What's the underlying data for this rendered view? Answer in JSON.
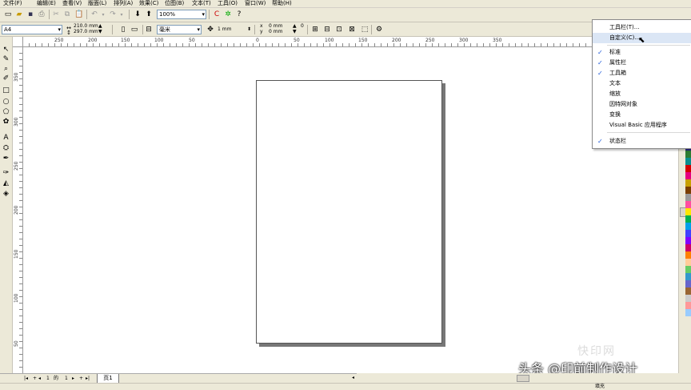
{
  "menu": [
    "文件(F)",
    "编辑(E)",
    "查看(V)",
    "版面(L)",
    "排列(A)",
    "效果(C)",
    "位图(B)",
    "文本(T)",
    "工具(O)",
    "窗口(W)",
    "帮助(H)"
  ],
  "toolbar": {
    "zoom": "100%"
  },
  "property_bar": {
    "paper_size": "A4",
    "width": "210.0 mm",
    "height": "297.0 mm",
    "units": "毫米",
    "nudge": "1 mm",
    "dup_x": "0 mm",
    "dup_y": "0 mm",
    "dup_x_label": "x",
    "dup_y_label": "y",
    "spin_val": "0"
  },
  "rulers": {
    "horizontal": [
      "250",
      "200",
      "150",
      "100",
      "50",
      "0",
      "50",
      "100",
      "150",
      "200",
      "250",
      "300",
      "350"
    ],
    "vertical": [
      "350",
      "300",
      "250",
      "200",
      "150",
      "100",
      "50"
    ]
  },
  "page_nav": {
    "current": "1",
    "of": "的",
    "total": "1",
    "tab": "页1"
  },
  "context_menu": {
    "items": [
      {
        "label": "工具栏(T)...",
        "checked": false
      },
      {
        "label": "自定义(C)...",
        "checked": false,
        "highlight": true
      },
      {
        "label": "标准",
        "checked": true
      },
      {
        "label": "属性栏",
        "checked": true
      },
      {
        "label": "工具箱",
        "checked": true
      },
      {
        "label": "文本",
        "checked": false
      },
      {
        "label": "缩放",
        "checked": false
      },
      {
        "label": "因特网对象",
        "checked": false
      },
      {
        "label": "变换",
        "checked": false
      },
      {
        "label": "Visual Basic 应用程序",
        "checked": false
      },
      {
        "label": "状态栏",
        "checked": true
      }
    ]
  },
  "palette": [
    "#000000",
    "#2b2b8c",
    "#2e7d32",
    "#0a8f8f",
    "#d40000",
    "#e6007e",
    "#c8a000",
    "#7a3e00",
    "#999999",
    "#ff4fa0",
    "#ffe600",
    "#00b050",
    "#00a0e9",
    "#4040ff",
    "#8000ff",
    "#cc0066",
    "#ff8000",
    "#ffcc99",
    "#66cc66",
    "#3399cc",
    "#6666cc",
    "#996633",
    "#cccccc",
    "#ff9999",
    "#99ccff"
  ],
  "watermark": {
    "text": "头条 @印前制作设计",
    "logo": "快印网"
  },
  "status": {
    "text": "填充"
  }
}
